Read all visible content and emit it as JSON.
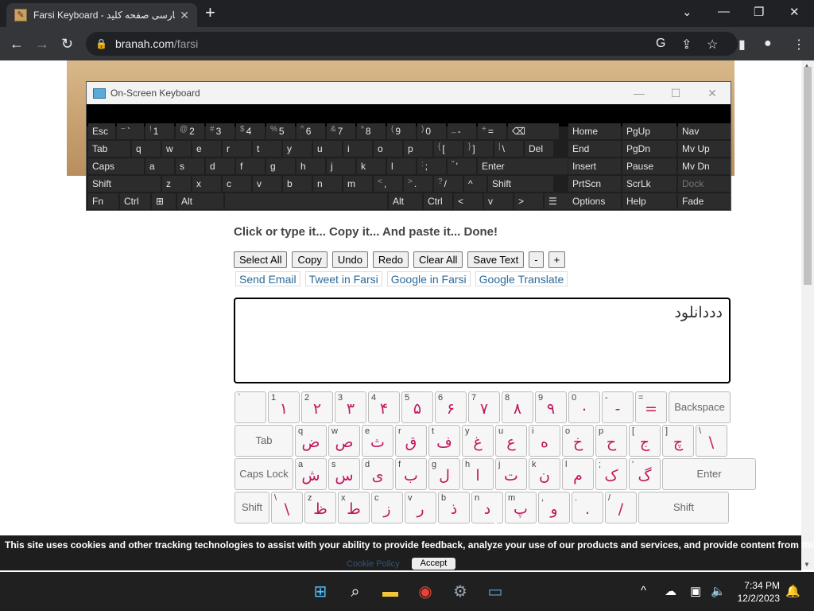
{
  "browser": {
    "tab_title": "Farsi Keyboard - فارسی صفحه کلید",
    "url_host": "branah.com",
    "url_path": "/farsi"
  },
  "osk": {
    "title": "On-Screen Keyboard",
    "rows": [
      [
        {
          "l": "Esc"
        },
        {
          "s": "~",
          "l": "`"
        },
        {
          "s": "!",
          "l": "1"
        },
        {
          "s": "@",
          "l": "2"
        },
        {
          "s": "#",
          "l": "3"
        },
        {
          "s": "$",
          "l": "4"
        },
        {
          "s": "%",
          "l": "5"
        },
        {
          "s": "^",
          "l": "6"
        },
        {
          "s": "&",
          "l": "7"
        },
        {
          "s": "*",
          "l": "8"
        },
        {
          "s": "(",
          "l": "9"
        },
        {
          "s": ")",
          "l": "0"
        },
        {
          "s": "_",
          "l": "-"
        },
        {
          "s": "+",
          "l": "="
        },
        {
          "l": "⌫"
        }
      ],
      [
        {
          "l": "Tab"
        },
        {
          "l": "q"
        },
        {
          "l": "w"
        },
        {
          "l": "e"
        },
        {
          "l": "r"
        },
        {
          "l": "t"
        },
        {
          "l": "y"
        },
        {
          "l": "u"
        },
        {
          "l": "i"
        },
        {
          "l": "o"
        },
        {
          "l": "p"
        },
        {
          "s": "{",
          "l": "["
        },
        {
          "s": "}",
          "l": "]"
        },
        {
          "s": "|",
          "l": "\\"
        },
        {
          "l": "Del"
        }
      ],
      [
        {
          "l": "Caps"
        },
        {
          "l": "a"
        },
        {
          "l": "s"
        },
        {
          "l": "d"
        },
        {
          "l": "f"
        },
        {
          "l": "g"
        },
        {
          "l": "h"
        },
        {
          "l": "j"
        },
        {
          "l": "k"
        },
        {
          "l": "l"
        },
        {
          "s": ":",
          "l": ";"
        },
        {
          "s": "\"",
          "l": "'"
        },
        {
          "l": "Enter"
        }
      ],
      [
        {
          "l": "Shift"
        },
        {
          "l": "z"
        },
        {
          "l": "x"
        },
        {
          "l": "c"
        },
        {
          "l": "v"
        },
        {
          "l": "b"
        },
        {
          "l": "n"
        },
        {
          "l": "m"
        },
        {
          "s": "<",
          "l": ","
        },
        {
          "s": ">",
          "l": "."
        },
        {
          "s": "?",
          "l": "/"
        },
        {
          "l": "^"
        },
        {
          "l": "Shift"
        }
      ],
      [
        {
          "l": "Fn"
        },
        {
          "l": "Ctrl"
        },
        {
          "l": "⊞"
        },
        {
          "l": "Alt"
        },
        {
          "l": ""
        },
        {
          "l": "Alt"
        },
        {
          "l": "Ctrl"
        },
        {
          "l": "<"
        },
        {
          "l": "v"
        },
        {
          "l": ">"
        },
        {
          "l": "☰"
        }
      ]
    ],
    "nav": [
      [
        "Home",
        "PgUp",
        "Nav"
      ],
      [
        "End",
        "PgDn",
        "Mv Up"
      ],
      [
        "Insert",
        "Pause",
        "Mv Dn"
      ],
      [
        "PrtScn",
        "ScrLk",
        "Dock"
      ],
      [
        "Options",
        "Help",
        "Fade"
      ]
    ]
  },
  "page": {
    "headline": "Click or type it... Copy it... And paste it... Done!",
    "buttons": [
      "Select All",
      "Copy",
      "Undo",
      "Redo",
      "Clear All",
      "Save Text",
      "-",
      "+"
    ],
    "links": [
      "Send Email",
      "Tweet in Farsi",
      "Google in Farsi",
      "Google Translate"
    ],
    "textarea_value": "دددانلود"
  },
  "farsi_keyboard": {
    "rows": [
      [
        {
          "en": "`",
          "fa": ""
        },
        {
          "en": "1",
          "fa": "۱"
        },
        {
          "en": "2",
          "fa": "۲"
        },
        {
          "en": "3",
          "fa": "۳"
        },
        {
          "en": "4",
          "fa": "۴"
        },
        {
          "en": "5",
          "fa": "۵"
        },
        {
          "en": "6",
          "fa": "۶"
        },
        {
          "en": "7",
          "fa": "۷"
        },
        {
          "en": "8",
          "fa": "۸"
        },
        {
          "en": "9",
          "fa": "۹"
        },
        {
          "en": "0",
          "fa": "۰"
        },
        {
          "en": "-",
          "fa": "-"
        },
        {
          "en": "=",
          "fa": "="
        },
        {
          "label": "Backspace"
        }
      ],
      [
        {
          "label": "Tab"
        },
        {
          "en": "q",
          "fa": "ض"
        },
        {
          "en": "w",
          "fa": "ص"
        },
        {
          "en": "e",
          "fa": "ث"
        },
        {
          "en": "r",
          "fa": "ق"
        },
        {
          "en": "t",
          "fa": "ف"
        },
        {
          "en": "y",
          "fa": "غ"
        },
        {
          "en": "u",
          "fa": "ع"
        },
        {
          "en": "i",
          "fa": "ه"
        },
        {
          "en": "o",
          "fa": "خ"
        },
        {
          "en": "p",
          "fa": "ح"
        },
        {
          "en": "[",
          "fa": "ج"
        },
        {
          "en": "]",
          "fa": "چ"
        },
        {
          "en": "\\",
          "fa": "\\"
        }
      ],
      [
        {
          "label": "Caps Lock"
        },
        {
          "en": "a",
          "fa": "ش"
        },
        {
          "en": "s",
          "fa": "س"
        },
        {
          "en": "d",
          "fa": "ی"
        },
        {
          "en": "f",
          "fa": "ب"
        },
        {
          "en": "g",
          "fa": "ل"
        },
        {
          "en": "h",
          "fa": "ا"
        },
        {
          "en": "j",
          "fa": "ت"
        },
        {
          "en": "k",
          "fa": "ن"
        },
        {
          "en": "l",
          "fa": "م"
        },
        {
          "en": ";",
          "fa": "ک"
        },
        {
          "en": "'",
          "fa": "گ"
        },
        {
          "label": "Enter"
        }
      ],
      [
        {
          "label": "Shift"
        },
        {
          "en": "\\",
          "fa": "\\"
        },
        {
          "en": "z",
          "fa": "ظ"
        },
        {
          "en": "x",
          "fa": "ط"
        },
        {
          "en": "c",
          "fa": "ز"
        },
        {
          "en": "v",
          "fa": "ر"
        },
        {
          "en": "b",
          "fa": "ذ"
        },
        {
          "en": "n",
          "fa": "د"
        },
        {
          "en": "m",
          "fa": "پ"
        },
        {
          "en": ",",
          "fa": "و"
        },
        {
          "en": ".",
          "fa": "."
        },
        {
          "en": "/",
          "fa": "/"
        },
        {
          "label": "Shift"
        }
      ]
    ]
  },
  "cookie": {
    "message": "This site uses cookies and other tracking technologies to assist with your ability to provide feedback, analyze your use of our products and services, and provide content from third parties.",
    "policy_link": "Cookie Policy",
    "accept": "Accept"
  },
  "taskbar": {
    "time": "7:34 PM",
    "date": "12/2/2023"
  }
}
